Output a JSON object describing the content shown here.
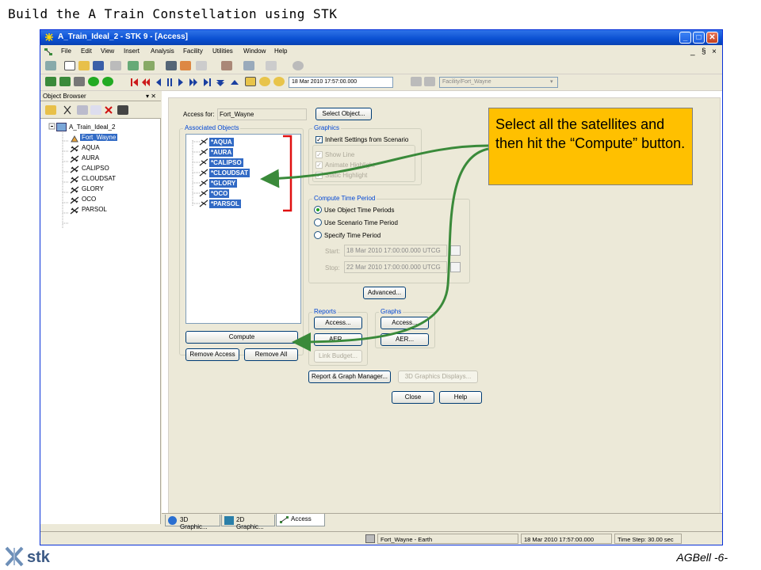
{
  "slide": {
    "title": "Build the A Train Constellation using STK",
    "footer_author": "AGBell -6-",
    "logo_text": "stk",
    "callout": "Select all the satellites and then hit the “Compute” button."
  },
  "window": {
    "title": "A_Train_Ideal_2 - STK 9 - [Access]",
    "controls": {
      "minimize": "_",
      "maximize": "□",
      "close": "✕"
    },
    "mdi_controls": [
      "_",
      "§",
      "×"
    ]
  },
  "menubar": {
    "items": [
      "File",
      "Edit",
      "View",
      "Insert",
      "Analysis",
      "Facility",
      "Utilities",
      "Window",
      "Help"
    ]
  },
  "toolbar": {
    "time_value": "18 Mar 2010 17:57:00.000",
    "object_select": "Facility/Fort_Wayne"
  },
  "browser": {
    "header": "Object Browser",
    "header_controls": "▾ ✕",
    "root": "A_Train_Ideal_2",
    "items": [
      {
        "label": "Fort_Wayne",
        "type": "facility",
        "selected": true
      },
      {
        "label": "AQUA",
        "type": "satellite"
      },
      {
        "label": "AURA",
        "type": "satellite"
      },
      {
        "label": "CALIPSO",
        "type": "satellite"
      },
      {
        "label": "CLOUDSAT",
        "type": "satellite"
      },
      {
        "label": "GLORY",
        "type": "satellite"
      },
      {
        "label": "OCO",
        "type": "satellite"
      },
      {
        "label": "PARSOL",
        "type": "satellite"
      }
    ]
  },
  "access": {
    "access_for_label": "Access for:",
    "access_for_value": "Fort_Wayne",
    "select_object_btn": "Select Object...",
    "associated_label": "Associated Objects",
    "associated": [
      "*AQUA",
      "*AURA",
      "*CALIPSO",
      "*CLOUDSAT",
      "*GLORY",
      "*OCO",
      "*PARSOL"
    ],
    "compute_btn": "Compute",
    "remove_access_btn": "Remove Access",
    "remove_all_btn": "Remove All",
    "graphics": {
      "label": "Graphics",
      "inherit": "Inherit Settings from Scenario",
      "show_line": "Show Line",
      "animate_highlight": "Animate Highlight",
      "static_highlight": "Static Highlight"
    },
    "time_period": {
      "label": "Compute Time Period",
      "use_object": "Use Object Time Periods",
      "use_scenario": "Use Scenario Time Period",
      "specify": "Specify Time Period",
      "start_label": "Start:",
      "start_value": "18 Mar 2010 17:00:00.000 UTCG",
      "stop_label": "Stop:",
      "stop_value": "22 Mar 2010 17:00:00.000 UTCG"
    },
    "advanced_btn": "Advanced...",
    "reports": {
      "label": "Reports",
      "access_btn": "Access...",
      "aer_btn": "AER...",
      "link_budget_btn": "Link Budget..."
    },
    "graphs": {
      "label": "Graphs",
      "access_btn": "Access...",
      "aer_btn": "AER..."
    },
    "report_graph_mgr_btn": "Report & Graph Manager...",
    "graphics_displays_btn": "3D Graphics Displays...",
    "close_btn": "Close",
    "help_btn": "Help"
  },
  "tabs": [
    "3D Graphic...",
    "2D Graphic...",
    "Access"
  ],
  "status": {
    "object": "Fort_Wayne - Earth",
    "time": "18 Mar 2010 17:57:00.000",
    "step": "Time Step: 30.00 sec"
  },
  "colors": {
    "selection": "#316ac5",
    "callout": "#ffc000",
    "arrow": "#3a8a3a",
    "bracket": "#e01010"
  }
}
